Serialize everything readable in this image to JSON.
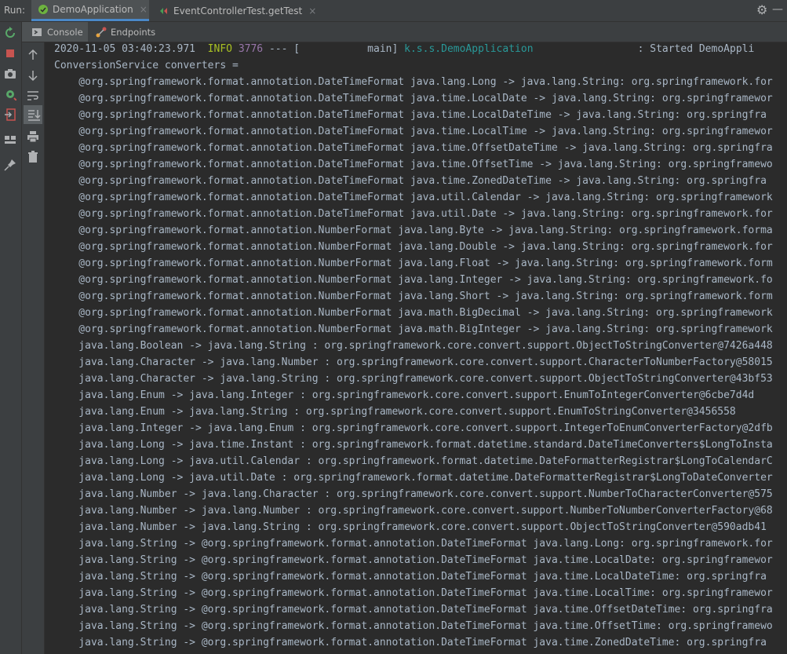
{
  "run_bar": {
    "label": "Run:",
    "tabs": [
      {
        "label": "DemoApplication",
        "active": true
      },
      {
        "label": "EventControllerTest.getTest",
        "active": false
      }
    ],
    "close_glyph": "×"
  },
  "sub_tabs": [
    {
      "label": "Console",
      "icon": "console-icon"
    },
    {
      "label": "Endpoints",
      "icon": "endpoints-icon"
    }
  ],
  "colors": {
    "background": "#2b2b2b",
    "toolbar": "#3c3f41",
    "text": "#a9b7c6",
    "info": "#a8c023",
    "pid": "#9876aa",
    "logger": "#299999"
  },
  "console": {
    "log_line": {
      "timestamp": "2020-11-05 03:40:23.971",
      "level": "INFO",
      "pid": "3776",
      "separator": "--- [",
      "thread": "           main]",
      "logger": "k.s.s.DemoApplication",
      "message": ": Started DemoAppli"
    },
    "header": "ConversionService converters =",
    "lines": [
      "    @org.springframework.format.annotation.DateTimeFormat java.lang.Long -> java.lang.String: org.springframework.for",
      "    @org.springframework.format.annotation.DateTimeFormat java.time.LocalDate -> java.lang.String: org.springframewor",
      "    @org.springframework.format.annotation.DateTimeFormat java.time.LocalDateTime -> java.lang.String: org.springfra",
      "    @org.springframework.format.annotation.DateTimeFormat java.time.LocalTime -> java.lang.String: org.springframewor",
      "    @org.springframework.format.annotation.DateTimeFormat java.time.OffsetDateTime -> java.lang.String: org.springfra",
      "    @org.springframework.format.annotation.DateTimeFormat java.time.OffsetTime -> java.lang.String: org.springframewo",
      "    @org.springframework.format.annotation.DateTimeFormat java.time.ZonedDateTime -> java.lang.String: org.springfra",
      "    @org.springframework.format.annotation.DateTimeFormat java.util.Calendar -> java.lang.String: org.springframework",
      "    @org.springframework.format.annotation.DateTimeFormat java.util.Date -> java.lang.String: org.springframework.for",
      "    @org.springframework.format.annotation.NumberFormat java.lang.Byte -> java.lang.String: org.springframework.forma",
      "    @org.springframework.format.annotation.NumberFormat java.lang.Double -> java.lang.String: org.springframework.for",
      "    @org.springframework.format.annotation.NumberFormat java.lang.Float -> java.lang.String: org.springframework.form",
      "    @org.springframework.format.annotation.NumberFormat java.lang.Integer -> java.lang.String: org.springframework.fo",
      "    @org.springframework.format.annotation.NumberFormat java.lang.Short -> java.lang.String: org.springframework.form",
      "    @org.springframework.format.annotation.NumberFormat java.math.BigDecimal -> java.lang.String: org.springframework",
      "    @org.springframework.format.annotation.NumberFormat java.math.BigInteger -> java.lang.String: org.springframework",
      "    java.lang.Boolean -> java.lang.String : org.springframework.core.convert.support.ObjectToStringConverter@7426a448",
      "    java.lang.Character -> java.lang.Number : org.springframework.core.convert.support.CharacterToNumberFactory@58015",
      "    java.lang.Character -> java.lang.String : org.springframework.core.convert.support.ObjectToStringConverter@43bf53",
      "    java.lang.Enum -> java.lang.Integer : org.springframework.core.convert.support.EnumToIntegerConverter@6cbe7d4d",
      "    java.lang.Enum -> java.lang.String : org.springframework.core.convert.support.EnumToStringConverter@3456558",
      "    java.lang.Integer -> java.lang.Enum : org.springframework.core.convert.support.IntegerToEnumConverterFactory@2dfb",
      "    java.lang.Long -> java.time.Instant : org.springframework.format.datetime.standard.DateTimeConverters$LongToInsta",
      "    java.lang.Long -> java.util.Calendar : org.springframework.format.datetime.DateFormatterRegistrar$LongToCalendarC",
      "    java.lang.Long -> java.util.Date : org.springframework.format.datetime.DateFormatterRegistrar$LongToDateConverter",
      "    java.lang.Number -> java.lang.Character : org.springframework.core.convert.support.NumberToCharacterConverter@575",
      "    java.lang.Number -> java.lang.Number : org.springframework.core.convert.support.NumberToNumberConverterFactory@68",
      "    java.lang.Number -> java.lang.String : org.springframework.core.convert.support.ObjectToStringConverter@590adb41",
      "    java.lang.String -> @org.springframework.format.annotation.DateTimeFormat java.lang.Long: org.springframework.for",
      "    java.lang.String -> @org.springframework.format.annotation.DateTimeFormat java.time.LocalDate: org.springframewor",
      "    java.lang.String -> @org.springframework.format.annotation.DateTimeFormat java.time.LocalDateTime: org.springfra",
      "    java.lang.String -> @org.springframework.format.annotation.DateTimeFormat java.time.LocalTime: org.springframewor",
      "    java.lang.String -> @org.springframework.format.annotation.DateTimeFormat java.time.OffsetDateTime: org.springfra",
      "    java.lang.String -> @org.springframework.format.annotation.DateTimeFormat java.time.OffsetTime: org.springframewo",
      "    java.lang.String -> @org.springframework.format.annotation.DateTimeFormat java.time.ZonedDateTime: org.springfra"
    ]
  }
}
